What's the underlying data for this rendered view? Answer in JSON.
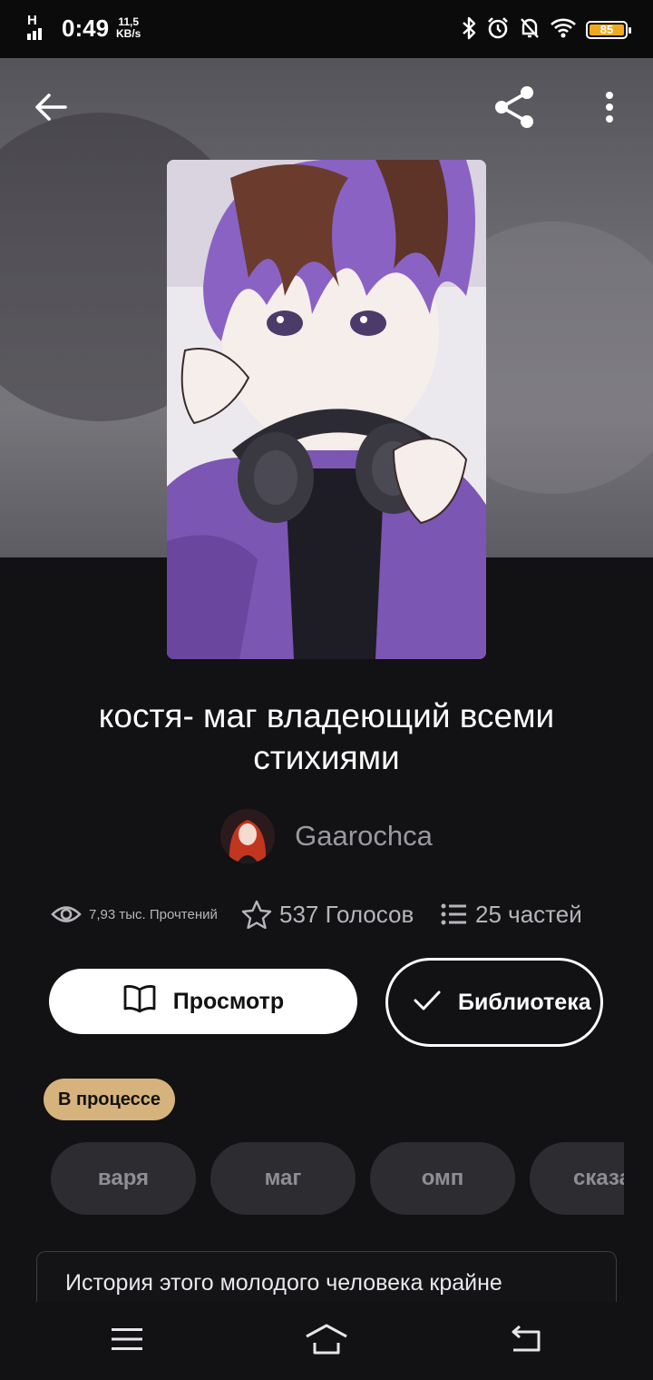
{
  "status_bar": {
    "network": "H",
    "time": "0:49",
    "speed_value": "11,5",
    "speed_unit": "KB/s",
    "battery": "85",
    "icons": [
      "bluetooth-icon",
      "alarm-icon",
      "dnd-off-icon",
      "wifi-icon",
      "battery-icon"
    ]
  },
  "header": {
    "back_icon": "arrow-left-icon",
    "share_icon": "share-icon",
    "menu_icon": "more-vertical-icon"
  },
  "story": {
    "title": "костя- маг владеющий всеми стихиями",
    "author": "Gaarochca",
    "reads": "7,93 тыс. Прочтений",
    "votes": "537 Голосов",
    "parts": "25 частей",
    "status": "В процессе",
    "description_preview": "История этого молодого человека крайне"
  },
  "actions": {
    "read_label": "Просмотр",
    "library_label": "Библиотека"
  },
  "tags": [
    "варя",
    "маг",
    "омп",
    "сказа"
  ],
  "colors": {
    "background": "#121113",
    "status_badge": "#d6b27c",
    "battery_fill": "#f0a91e",
    "tag_bg": "#2d2c30"
  }
}
